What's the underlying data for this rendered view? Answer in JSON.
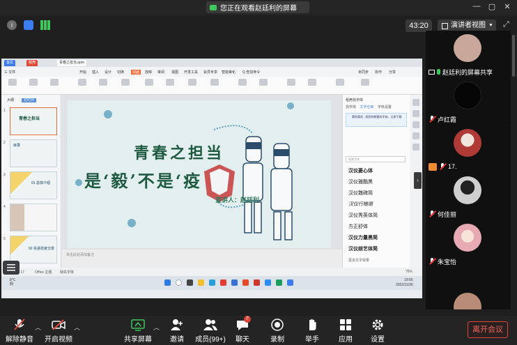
{
  "title_bar": {
    "share_notice": "您正在观看赵廷利的屏幕",
    "controls": [
      "minimize-icon",
      "restore-icon",
      "close-icon"
    ]
  },
  "toolbar": {
    "icons": [
      "info-icon",
      "shield-icon",
      "signal-icon"
    ],
    "timer": "43:20",
    "view_label": "演讲者视图",
    "view_icon": "grid-icon",
    "expand_icon": "fullscreen-icon"
  },
  "shared_screen": {
    "wps_tabs": [
      "首页",
      "稻壳",
      "青春之担当.pptx"
    ],
    "menu": [
      "三 文件",
      "开始",
      "插入",
      "设计",
      "切换",
      "动画",
      "放映",
      "审阅",
      "视图",
      "开发工具",
      "会员专享",
      "智能美化",
      "Q 查找命令",
      "未同步",
      "协作",
      "分享"
    ],
    "thumb_tabs": [
      "大纲",
      "幻灯片"
    ],
    "thumbs": [
      {
        "num": "1",
        "text": "青春之担当"
      },
      {
        "num": "2",
        "text": "目录"
      },
      {
        "num": "3",
        "text": "01 总体介绍"
      },
      {
        "num": "4",
        "text": ""
      },
      {
        "num": "5",
        "text": "02 先进抗疫分享"
      }
    ],
    "slide": {
      "line1": "青春之担当",
      "line2": "是‘毅’不是‘疫",
      "speaker": "宣讲人：赵廷利"
    },
    "notes_placeholder": "单击此处添加备注",
    "right_pane": {
      "header": "稻壳找字体",
      "tabs": [
        "找字体",
        "文字仓库",
        "字体设置"
      ],
      "info": "猜你喜欢 - 找到你想要的字体，立即下载",
      "search_placeholder": "搜索字体",
      "fonts": [
        "汉仪菱心体",
        "汉仪雅酷黑",
        "汉仪魏碑简",
        "汉仪行楷简",
        "汉仪秀英体简",
        "方正舒体",
        "汉仪力量黑简",
        "汉仪综艺体简"
      ],
      "more": "更多文字效果"
    },
    "status": {
      "slide_counter": "幻灯片 1 / 17",
      "theme": "Office 主题",
      "missing_font": "缺失字体",
      "zoom": "76%"
    },
    "taskbar": {
      "weather_temp": "8°C",
      "weather_desc": "阴",
      "time": "19:56",
      "date": "2022/11/30"
    }
  },
  "participants": [
    {
      "name": "赵廷利的屏幕共享",
      "status": "screen-share",
      "avatar_color": "#c9a79b"
    },
    {
      "name": "卢红霞",
      "status": "mic-off",
      "avatar_color": "#050505"
    },
    {
      "name": "17.",
      "status": "mic-off",
      "avatar_color": "#b03a35"
    },
    {
      "name": "何佳丽",
      "status": "mic-off",
      "avatar_color": "#cfcfcf"
    },
    {
      "name": "朱宝怡",
      "status": "mic-off",
      "avatar_color": "#e7a9b2"
    },
    {
      "name": "",
      "status": "",
      "avatar_color": "#b88c76"
    }
  ],
  "bottom_bar": {
    "unmute": "解除静音",
    "video": "开启视频",
    "share": "共享屏幕",
    "invite": "邀请",
    "members": "成员(99+)",
    "chat": "聊天",
    "chat_badge": "7",
    "record": "录制",
    "raise_hand": "举手",
    "apps": "应用",
    "settings": "设置",
    "leave": "离开会议"
  },
  "colors": {
    "accent_green": "#3cc85b",
    "leave_red": "#e0443b",
    "slide_green": "#1e5a42",
    "wps_orange": "#f06b3a"
  }
}
